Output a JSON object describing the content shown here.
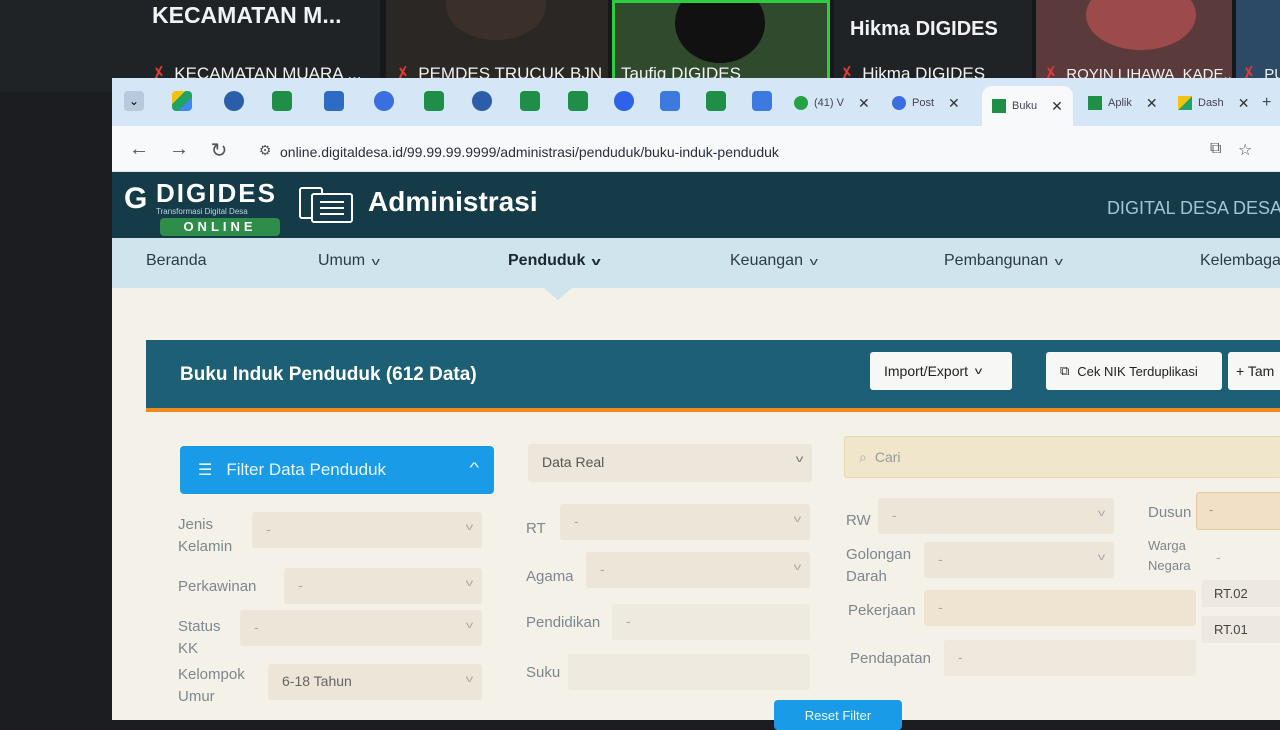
{
  "video_call": {
    "participants": [
      {
        "name": "KECAMATAN MUARA ...",
        "big_name": "KECAMATAN  M...",
        "muted": true
      },
      {
        "name": "PEMDES TRUCUK BJN",
        "muted": true
      },
      {
        "name": "Taufiq DIGIDES",
        "muted": false,
        "speaking": true
      },
      {
        "name": "Hikma DIGIDES",
        "big_name": "Hikma DIGIDES",
        "muted": true
      },
      {
        "name": "ROYIN LIHAWA_KADE...",
        "muted": true
      },
      {
        "name": "PU",
        "muted": true
      }
    ]
  },
  "browser": {
    "tabs": [
      {
        "label": "(41) V",
        "icon": "whatsapp-icon"
      },
      {
        "label": "Post",
        "icon": "generic-tab-icon"
      },
      {
        "label": "Buku",
        "icon": "sheet-icon",
        "active": true
      },
      {
        "label": "Aplik",
        "icon": "sheet-icon"
      },
      {
        "label": "Dash",
        "icon": "drive-icon"
      }
    ],
    "new_tab": "+",
    "url": "online.digitaldesa.id/99.99.99.9999/administrasi/penduduk/buku-induk-penduduk"
  },
  "app": {
    "logo_name": "DIGIDES",
    "logo_tagline": "Transformasi Digital Desa",
    "logo_badge": "ONLINE",
    "title": "Administrasi",
    "right_text": "DIGITAL DESA DESA",
    "menu": [
      {
        "label": "Beranda",
        "dropdown": false
      },
      {
        "label": "Umum",
        "dropdown": true
      },
      {
        "label": "Penduduk",
        "dropdown": true,
        "active": true
      },
      {
        "label": "Keuangan",
        "dropdown": true
      },
      {
        "label": "Pembangunan",
        "dropdown": true
      },
      {
        "label": "Kelembaga",
        "dropdown": false
      }
    ]
  },
  "panel": {
    "title": "Buku Induk Penduduk (612 Data)",
    "import_export": "Import/Export",
    "cek_nik": "Cek NIK Terduplikasi",
    "tambah": "+ Tam"
  },
  "filters": {
    "toggle_label": "Filter Data Penduduk",
    "data_source": "Data Real",
    "search_placeholder": "Cari",
    "fields": [
      {
        "label": "Jenis Kelamin",
        "value": "-"
      },
      {
        "label": "RT",
        "value": "-"
      },
      {
        "label": "RW",
        "value": "-"
      },
      {
        "label": "Dusun",
        "value": "-"
      },
      {
        "label": "Perkawinan",
        "value": "-"
      },
      {
        "label": "Agama",
        "value": "-"
      },
      {
        "label": "Golongan Darah",
        "value": "-"
      },
      {
        "label": "Warga Negara",
        "value": "-"
      },
      {
        "label": "Status KK",
        "value": "-"
      },
      {
        "label": "Pendidikan",
        "value": "-"
      },
      {
        "label": "Pekerjaan",
        "value": "-"
      },
      {
        "label": "Kelompok Umur",
        "value": "6-18 Tahun"
      },
      {
        "label": "Suku",
        "value": ""
      },
      {
        "label": "Pendapatan",
        "value": "-"
      }
    ],
    "dusun_options": [
      "RT.02",
      "RT.01"
    ],
    "reset_label": "Reset Filter"
  }
}
